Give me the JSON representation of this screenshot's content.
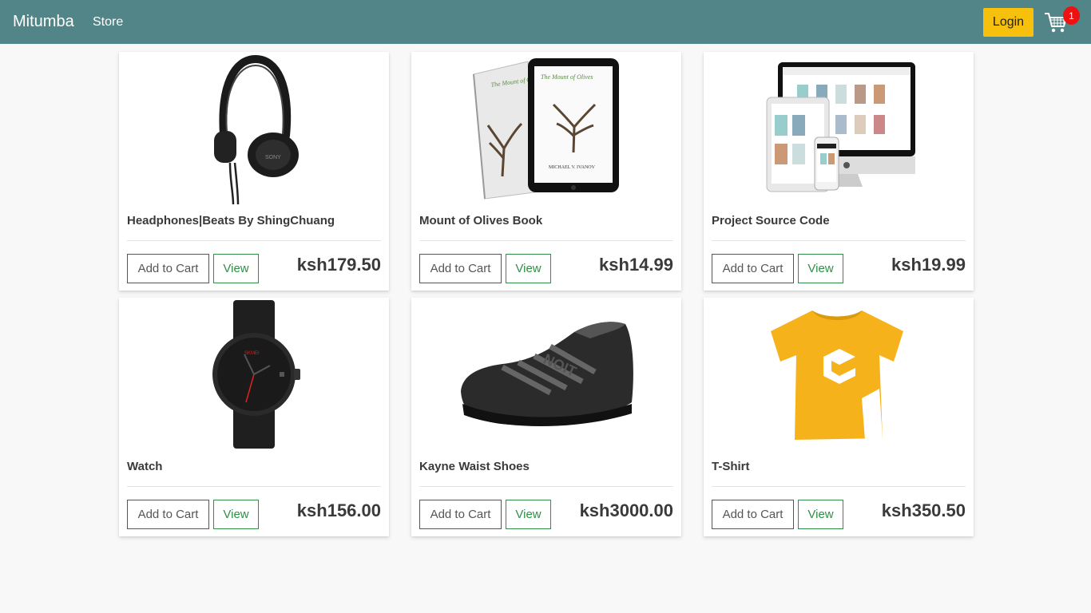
{
  "navbar": {
    "brand": "Mitumba",
    "store_link": "Store",
    "login_label": "Login",
    "cart_count": "1",
    "cart_icon": "shopping-cart-icon",
    "colors": {
      "bar": "#528587",
      "login": "#f7c00d",
      "badge": "#ee1111"
    }
  },
  "products": [
    {
      "title": "Headphones|Beats By ShingChuang",
      "price": "ksh179.50",
      "add_label": "Add to Cart",
      "view_label": "View",
      "image": "headphones-image"
    },
    {
      "title": "Mount of Olives Book",
      "price": "ksh14.99",
      "add_label": "Add to Cart",
      "view_label": "View",
      "image": "book-image"
    },
    {
      "title": "Project Source Code",
      "price": "ksh19.99",
      "add_label": "Add to Cart",
      "view_label": "View",
      "image": "devices-image"
    },
    {
      "title": "Watch",
      "price": "ksh156.00",
      "add_label": "Add to Cart",
      "view_label": "View",
      "image": "watch-image"
    },
    {
      "title": "Kayne Waist Shoes",
      "price": "ksh3000.00",
      "add_label": "Add to Cart",
      "view_label": "View",
      "image": "shoe-image"
    },
    {
      "title": "T-Shirt",
      "price": "ksh350.50",
      "add_label": "Add to Cart",
      "view_label": "View",
      "image": "tshirt-image"
    }
  ],
  "book_cover_text": {
    "title": "The Mount of Olives",
    "author": "MICHAEL V. IVANOV"
  }
}
